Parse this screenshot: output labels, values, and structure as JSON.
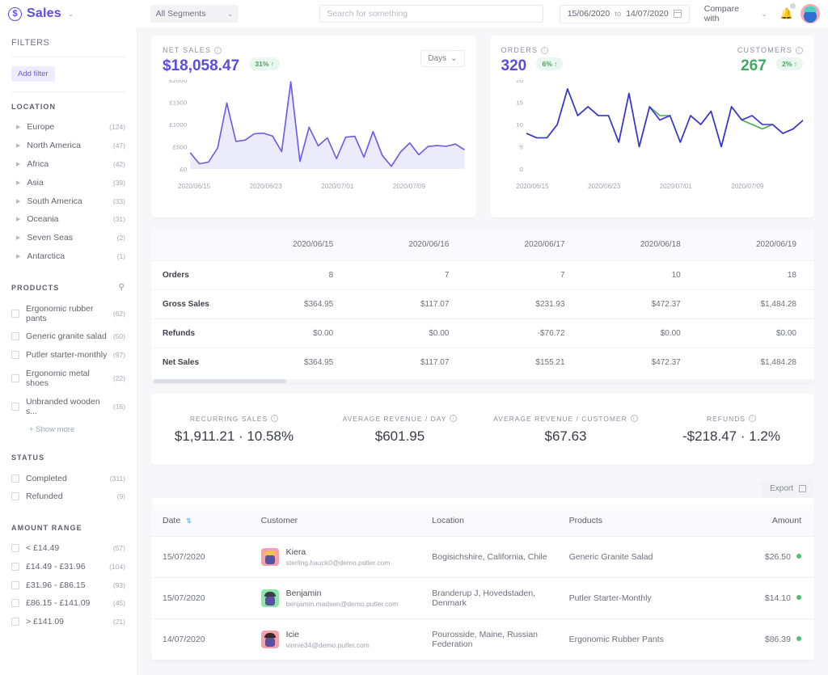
{
  "topbar": {
    "brand_icon": "dollar-circle-icon",
    "brand": "Sales",
    "brand_caret": "⌄",
    "segments_label": "All Segments",
    "segments_caret": "⌄",
    "search_placeholder": "Search for something",
    "search_value": "",
    "date_from": "15/06/2020",
    "date_to_sep": "to",
    "date_to": "14/07/2020",
    "compare_label": "Compare with",
    "compare_caret": "⌄",
    "bell_icon": "bell-icon"
  },
  "sidebar": {
    "title": "FILTERS",
    "add_filter": "Add filter",
    "location": {
      "heading": "LOCATION",
      "items": [
        {
          "label": "Europe",
          "count": "(124)"
        },
        {
          "label": "North America",
          "count": "(47)"
        },
        {
          "label": "Africa",
          "count": "(42)"
        },
        {
          "label": "Asia",
          "count": "(39)"
        },
        {
          "label": "South America",
          "count": "(33)"
        },
        {
          "label": "Oceania",
          "count": "(31)"
        },
        {
          "label": "Seven Seas",
          "count": "(2)"
        },
        {
          "label": "Antarctica",
          "count": "(1)"
        }
      ]
    },
    "products": {
      "heading": "PRODUCTS",
      "search_icon": "search-icon",
      "items": [
        {
          "label": "Ergonomic rubber pants",
          "count": "(62)"
        },
        {
          "label": "Generic granite salad",
          "count": "(50)"
        },
        {
          "label": "Putler starter-monthly",
          "count": "(97)"
        },
        {
          "label": "Ergonomic metal shoes",
          "count": "(22)"
        },
        {
          "label": "Unbranded wooden s...",
          "count": "(16)"
        }
      ],
      "show_more": "+ Show more"
    },
    "status": {
      "heading": "STATUS",
      "items": [
        {
          "label": "Completed",
          "count": "(311)"
        },
        {
          "label": "Refunded",
          "count": "(9)"
        }
      ]
    },
    "amount_range": {
      "heading": "AMOUNT RANGE",
      "items": [
        {
          "label": "< £14.49",
          "count": "(57)"
        },
        {
          "label": "£14.49 - £31.96",
          "count": "(104)"
        },
        {
          "label": "£31.96 - £86.15",
          "count": "(93)"
        },
        {
          "label": "£86.15 - £141.09",
          "count": "(45)"
        },
        {
          "label": "> £141.09",
          "count": "(21)"
        }
      ]
    }
  },
  "net_sales_card": {
    "label": "NET SALES",
    "info_icon": "info-icon",
    "value": "$18,058.47",
    "delta": "31% ↑",
    "days_button": "Days",
    "days_caret": "⌄"
  },
  "orders_card": {
    "orders_label": "ORDERS",
    "orders_value": "320",
    "orders_delta": "6% ↑",
    "customers_label": "CUSTOMERS",
    "customers_value": "267",
    "customers_delta": "2% ↑"
  },
  "chart_data": [
    {
      "type": "area",
      "title": "NET SALES",
      "xlabel": "",
      "ylabel": "",
      "ylim": [
        0,
        2000
      ],
      "yticks": [
        "£0",
        "£500",
        "£1000",
        "£1500",
        "£2000"
      ],
      "grid": false,
      "legend": "none",
      "line_color": "#6c5ce7",
      "fill_color": "#ecebfb",
      "x": [
        "2020/06/15",
        "2020/06/16",
        "2020/06/17",
        "2020/06/18",
        "2020/06/19",
        "2020/06/20",
        "2020/06/21",
        "2020/06/22",
        "2020/06/23",
        "2020/06/24",
        "2020/06/25",
        "2020/06/26",
        "2020/06/27",
        "2020/06/28",
        "2020/06/29",
        "2020/06/30",
        "2020/07/01",
        "2020/07/02",
        "2020/07/03",
        "2020/07/04",
        "2020/07/05",
        "2020/07/06",
        "2020/07/07",
        "2020/07/08",
        "2020/07/09",
        "2020/07/10",
        "2020/07/11",
        "2020/07/12",
        "2020/07/13",
        "2020/07/14"
      ],
      "xtick_labels": [
        "2020/06/15",
        "2020/06/23",
        "2020/07/01",
        "2020/07/09"
      ],
      "values": [
        365,
        117,
        155,
        472,
        1484,
        620,
        650,
        790,
        805,
        740,
        390,
        1960,
        170,
        940,
        520,
        700,
        230,
        715,
        735,
        265,
        840,
        305,
        60,
        380,
        585,
        320,
        505,
        525,
        510,
        560,
        430
      ]
    },
    {
      "type": "line",
      "title": "ORDERS / CUSTOMERS",
      "xlabel": "",
      "ylabel": "",
      "ylim": [
        0,
        20
      ],
      "yticks": [
        "0",
        "5",
        "10",
        "15",
        "20"
      ],
      "grid": false,
      "legend": "none",
      "xtick_labels": [
        "2020/06/15",
        "2020/06/23",
        "2020/07/01",
        "2020/07/09"
      ],
      "series": [
        {
          "name": "Orders",
          "color": "#3b32d6",
          "values": [
            8,
            7,
            7,
            10,
            18,
            12,
            14,
            12,
            12,
            6,
            17,
            5,
            14,
            11,
            12,
            6,
            12,
            10,
            13,
            5,
            14,
            11,
            12,
            10,
            10,
            8,
            9,
            11
          ]
        },
        {
          "name": "Customers",
          "color": "#4caf50",
          "values": [
            8,
            7,
            7,
            10,
            18,
            12,
            14,
            12,
            12,
            6,
            17,
            5,
            14,
            12,
            12,
            6,
            12,
            10,
            13,
            5,
            14,
            11,
            10,
            9,
            10,
            8,
            9,
            11
          ]
        }
      ]
    }
  ],
  "daily_grid": {
    "columns": [
      "",
      "2020/06/15",
      "2020/06/16",
      "2020/06/17",
      "2020/06/18",
      "2020/06/19"
    ],
    "rows": [
      {
        "label": "Orders",
        "cells": [
          "8",
          "7",
          "7",
          "10",
          "18"
        ]
      },
      {
        "label": "Gross Sales",
        "cells": [
          "$364.95",
          "$117.07",
          "$231.93",
          "$472.37",
          "$1,484.28"
        ]
      },
      {
        "label": "Refunds",
        "cells": [
          "$0.00",
          "$0.00",
          "-$76.72",
          "$0.00",
          "$0.00"
        ]
      },
      {
        "label": "Net Sales",
        "cells": [
          "$364.95",
          "$117.07",
          "$155.21",
          "$472.37",
          "$1,484.28"
        ]
      }
    ]
  },
  "metrics": [
    {
      "label": "RECURRING SALES",
      "value": "$1,911.21 · 10.58%"
    },
    {
      "label": "AVERAGE REVENUE / DAY",
      "value": "$601.95"
    },
    {
      "label": "AVERAGE REVENUE / CUSTOMER",
      "value": "$67.63"
    },
    {
      "label": "REFUNDS",
      "value": "-$218.47 · 1.2%"
    }
  ],
  "transactions": {
    "export_label": "Export",
    "export_icon": "export-icon",
    "columns": {
      "date": "Date",
      "customer": "Customer",
      "location": "Location",
      "products": "Products",
      "amount": "Amount"
    },
    "sort_icon": "sort-icon",
    "rows": [
      {
        "date": "15/07/2020",
        "name": "Kiera",
        "email": "sterling.hauck0@demo.putler.com",
        "avatar_bg": "#f6a0ab",
        "avatar_hair": "#f2c14e",
        "avatar_face": "#5b4fa0",
        "location": "Bogisichshire, California, Chile",
        "product": "Generic Granite Salad",
        "amount": "$26.50"
      },
      {
        "date": "15/07/2020",
        "name": "Benjamin",
        "email": "benjamin.madsen@demo.putler.com",
        "avatar_bg": "#8ce8a8",
        "avatar_hair": "#3c3c4a",
        "avatar_face": "#5b4fa0",
        "location": "Branderup J, Hovedstaden, Denmark",
        "product": "Putler Starter-Monthly",
        "amount": "$14.10"
      },
      {
        "date": "14/07/2020",
        "name": "Icie",
        "email": "vinnie34@demo.putler.com",
        "avatar_bg": "#f6a0ab",
        "avatar_hair": "#3a2a22",
        "avatar_face": "#5b4fa0",
        "location": "Pourosside, Maine, Russian Federation",
        "product": "Ergonomic Rubber Pants",
        "amount": "$86.39"
      }
    ]
  }
}
